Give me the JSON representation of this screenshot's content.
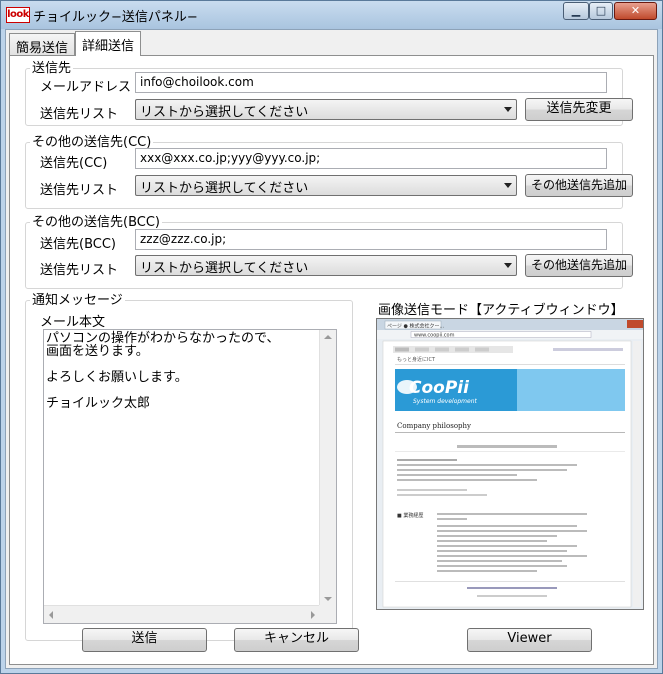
{
  "window": {
    "app_logo_text": "look",
    "title": "チョイルック−送信パネル−",
    "controls": {
      "minimize": "▁",
      "maximize": "□",
      "close": "✕"
    }
  },
  "tabs": [
    {
      "label": "簡易送信",
      "active": false
    },
    {
      "label": "詳細送信",
      "active": true
    }
  ],
  "to_group": {
    "legend": "送信先",
    "email_label": "メールアドレス",
    "email_value": "info@choilook.com",
    "list_label": "送信先リスト",
    "list_selected": "リストから選択してください",
    "change_button": "送信先変更"
  },
  "cc_group": {
    "legend": "その他の送信先(CC)",
    "to_label": "送信先(CC)",
    "to_value": "xxx@xxx.co.jp;yyy@yyy.co.jp;",
    "list_label": "送信先リスト",
    "list_selected": "リストから選択してください",
    "add_button": "その他送信先追加"
  },
  "bcc_group": {
    "legend": "その他の送信先(BCC)",
    "to_label": "送信先(BCC)",
    "to_value": "zzz@zzz.co.jp;",
    "list_label": "送信先リスト",
    "list_selected": "リストから選択してください",
    "add_button": "その他送信先追加"
  },
  "message_group": {
    "legend": "通知メッセージ",
    "body_label": "メール本文",
    "body_lines": [
      "パソコンの操作がわからなかったので、",
      "画面を送ります。",
      "",
      "よろしくお願いします。",
      "",
      "チョイルック太郎"
    ]
  },
  "image_mode": {
    "label": "画像送信モード【アクティブウィンドウ】"
  },
  "screenshot_preview": {
    "browser_tab": "ページ ● 株式会社クー...",
    "address": "www.coopii.com",
    "tagline": "もっと身近にICT",
    "logo_main": "CooPii",
    "logo_sub": "System development",
    "heading": "Company philosophy",
    "section_label": "■ 業務経歴"
  },
  "buttons": {
    "send": "送信",
    "cancel": "キャンセル",
    "viewer": "Viewer"
  },
  "colors": {
    "title_bar": "#bcd3ea",
    "close_button": "#c04a2c",
    "logo_red": "#cc0000",
    "preview_banner": "#2b9ad6"
  }
}
